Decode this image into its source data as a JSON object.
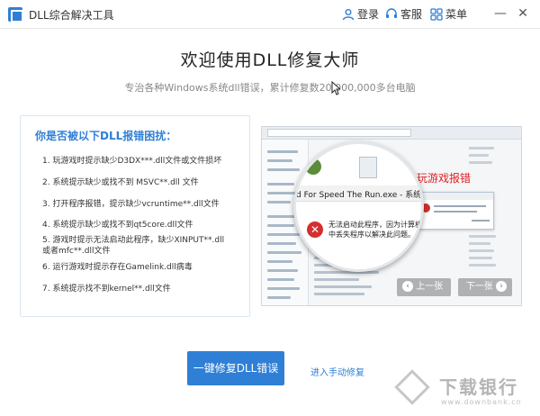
{
  "app": {
    "title": "DLL综合解决工具",
    "accent_color": "#2f7fd6",
    "icon": "app-logo-icon"
  },
  "titlebar": {
    "login": "登录",
    "service": "客服",
    "menu": "菜单",
    "login_icon": "user-icon",
    "service_icon": "headset-icon",
    "menu_icon": "grid-icon",
    "minimize": "—",
    "close": "✕"
  },
  "hero": {
    "title": "欢迎使用DLL修复大师",
    "subtitle": "专治各种Windows系统dll错误，累计修复数20,000,000多台电脑"
  },
  "issues": {
    "heading": "你是否被以下DLL报错困扰：",
    "items": [
      "1. 玩游戏时提示缺少D3DX***.dll文件或文件损坏",
      "2. 系统提示缺少或找不到 MSVC**.dll 文件",
      "3. 打开程序报错，提示缺少vcruntime**.dll文件",
      "4. 系统提示缺少或找不到qt5core.dll文件",
      "5. 游戏时提示无法启动此程序，缺少XINPUT**.dll或者mfc**.dll文件",
      "6. 运行游戏时提示存在Gamelink.dll病毒",
      "7. 系统提示找不到kernel**.dll文件"
    ]
  },
  "preview": {
    "label": "玩游戏报错",
    "dialog_title": "d For Speed The Run.exe - 系统错误",
    "dialog_message": "无法启动此程序，因为计算机中丢失程序以解决此问题。",
    "prev": "上一张",
    "next": "下一张"
  },
  "actions": {
    "primary": "一键修复DLL错误",
    "manual": "进入手动修复"
  },
  "watermark": {
    "text": "下载银行",
    "url": "www.downbank.cn"
  }
}
